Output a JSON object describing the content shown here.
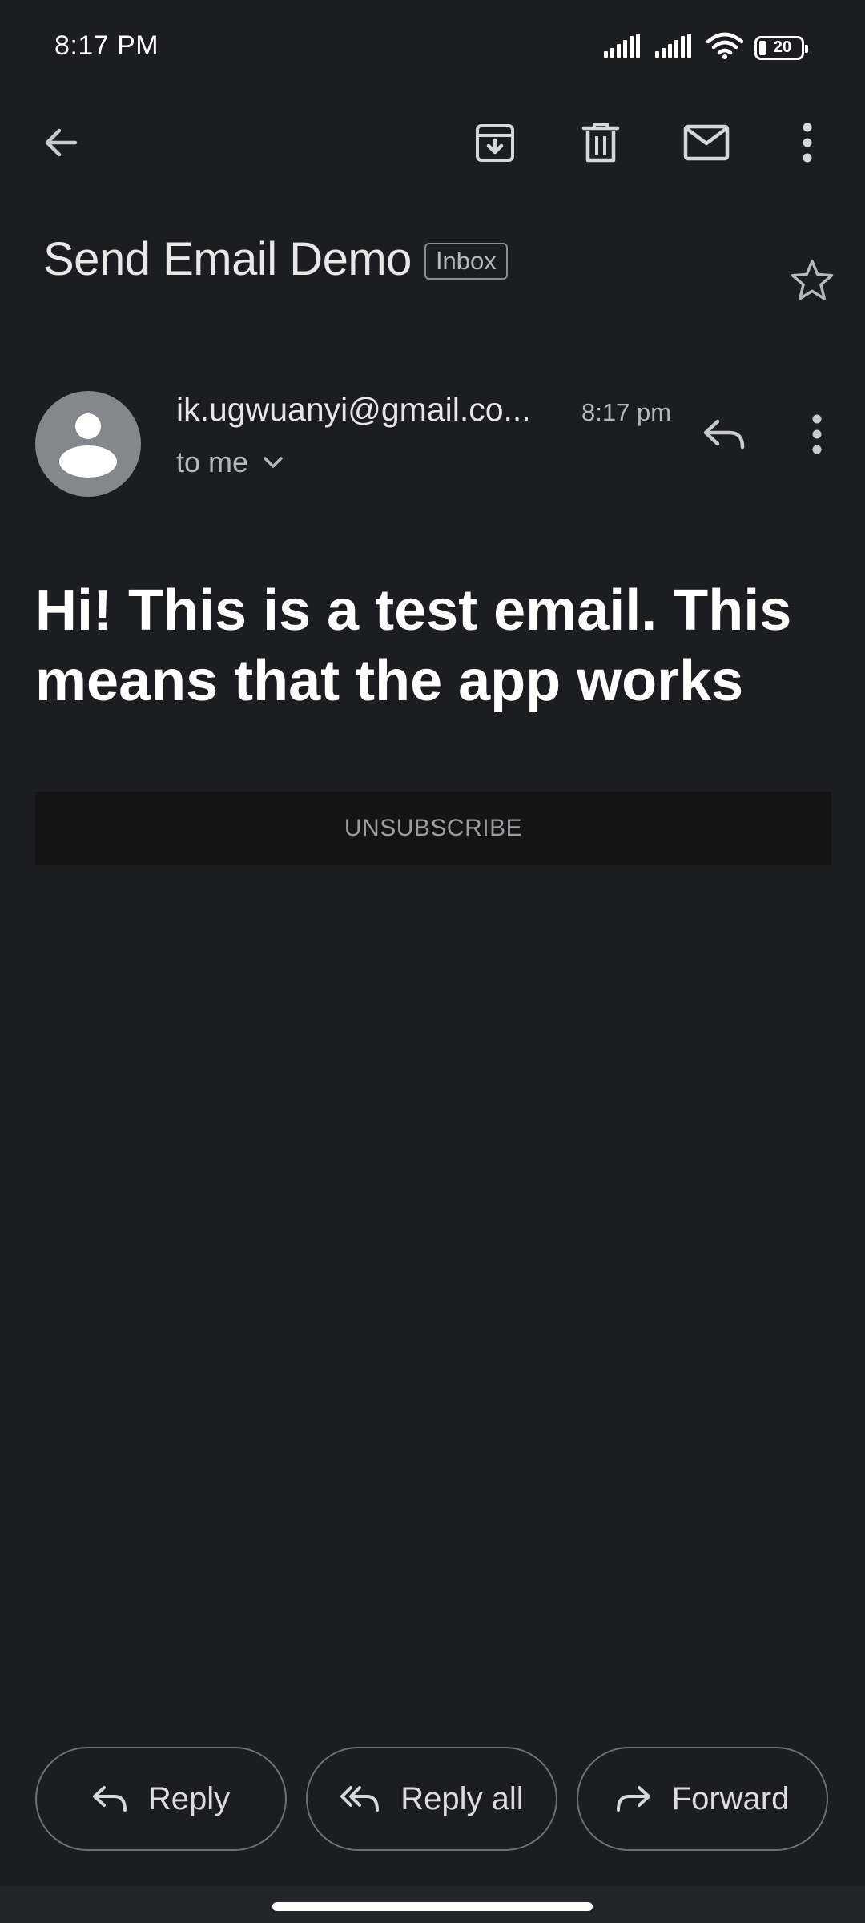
{
  "status_bar": {
    "time": "8:17 PM",
    "battery": "20",
    "icons": [
      "signal-icon",
      "signal-icon",
      "wifi-icon",
      "battery-icon"
    ]
  },
  "toolbar": {
    "icons": [
      "back-arrow-icon",
      "archive-icon",
      "delete-icon",
      "mark-unread-icon",
      "more-vert-icon"
    ]
  },
  "email": {
    "subject": "Send Email Demo",
    "label": "Inbox",
    "sender": "ik.ugwuanyi@gmail.co...",
    "time": "8:17 pm",
    "recipient": "to me",
    "body": "Hi! This is a test email. This means that the app works",
    "unsubscribe": "UNSUBSCRIBE"
  },
  "actions": {
    "reply": "Reply",
    "reply_all": "Reply all",
    "forward": "Forward"
  },
  "colors": {
    "background": "#1c1d20",
    "avatar": "#84878c",
    "unsubscribe_bg": "#141415"
  }
}
